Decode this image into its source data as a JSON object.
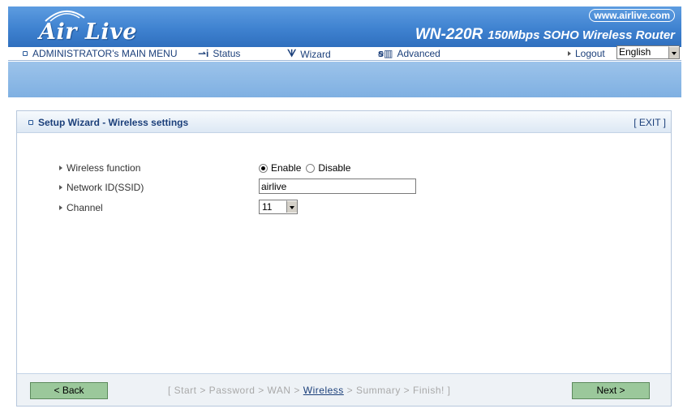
{
  "header": {
    "brand": "Air Live",
    "site_url": "www.airlive.com",
    "model_name": "WN-220R",
    "model_desc": "150Mbps SOHO Wireless Router"
  },
  "menu": {
    "main": "ADMINISTRATOR's MAIN MENU",
    "status": "Status",
    "wizard": "Wizard",
    "advanced": "Advanced",
    "logout": "Logout",
    "language": "English"
  },
  "panel": {
    "title": "Setup Wizard - Wireless settings",
    "exit": "[ EXIT ]"
  },
  "form": {
    "wireless_label": "Wireless function",
    "enable_label": "Enable",
    "disable_label": "Disable",
    "wireless_value": "Enable",
    "ssid_label": "Network ID(SSID)",
    "ssid_value": "airlive",
    "channel_label": "Channel",
    "channel_value": "11"
  },
  "footer": {
    "back": "< Back",
    "next": "Next >",
    "steps_before": "[ Start > Password > WAN > ",
    "steps_current": "Wireless",
    "steps_after": " > Summary > Finish! ]"
  },
  "colors": {
    "header_blue": "#3f82d0",
    "button_green": "#9bc89b",
    "link_blue": "#1b3f7a"
  }
}
